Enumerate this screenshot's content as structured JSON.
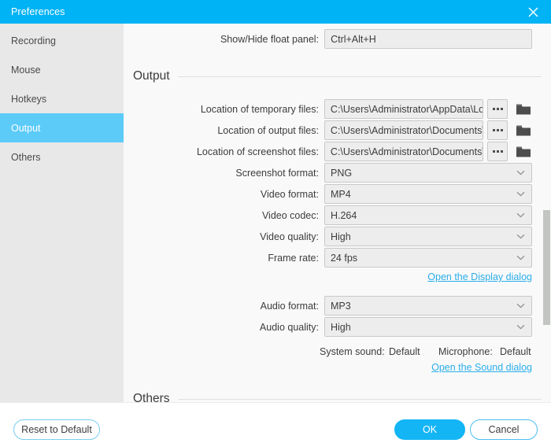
{
  "window": {
    "title": "Preferences",
    "close_icon": "close-icon"
  },
  "sidebar": {
    "items": [
      {
        "label": "Recording",
        "active": false
      },
      {
        "label": "Mouse",
        "active": false
      },
      {
        "label": "Hotkeys",
        "active": false
      },
      {
        "label": "Output",
        "active": true
      },
      {
        "label": "Others",
        "active": false
      }
    ]
  },
  "content": {
    "hotkey_row": {
      "label": "Show/Hide float panel:",
      "value": "Ctrl+Alt+H"
    },
    "sections": {
      "output": "Output",
      "others": "Others"
    },
    "paths": [
      {
        "label": "Location of temporary files:",
        "value": "C:\\Users\\Administrator\\AppData\\Lo",
        "browse_icon": "ellipsis-icon",
        "folder_icon": "folder-icon"
      },
      {
        "label": "Location of output files:",
        "value": "C:\\Users\\Administrator\\Documents\\",
        "browse_icon": "ellipsis-icon",
        "folder_icon": "folder-icon"
      },
      {
        "label": "Location of screenshot files:",
        "value": "C:\\Users\\Administrator\\Documents\\",
        "browse_icon": "ellipsis-icon",
        "folder_icon": "folder-icon"
      }
    ],
    "video_combos": [
      {
        "label": "Screenshot format:",
        "value": "PNG"
      },
      {
        "label": "Video format:",
        "value": "MP4"
      },
      {
        "label": "Video codec:",
        "value": "H.264"
      },
      {
        "label": "Video quality:",
        "value": "High"
      },
      {
        "label": "Frame rate:",
        "value": "24 fps"
      }
    ],
    "display_link": "Open the Display dialog",
    "audio_combos": [
      {
        "label": "Audio format:",
        "value": "MP3"
      },
      {
        "label": "Audio quality:",
        "value": "High"
      }
    ],
    "devices": {
      "system_sound_label": "System sound:",
      "system_sound_value": "Default",
      "microphone_label": "Microphone:",
      "microphone_value": "Default"
    },
    "sound_link": "Open the Sound dialog"
  },
  "footer": {
    "reset": "Reset to Default",
    "ok": "OK",
    "cancel": "Cancel"
  },
  "colors": {
    "accent": "#00b3f4",
    "accent_selected": "#5ccbf8",
    "link": "#2aaee8",
    "sidebar_bg": "#e8e8e8",
    "content_bg": "#faf9fa"
  }
}
